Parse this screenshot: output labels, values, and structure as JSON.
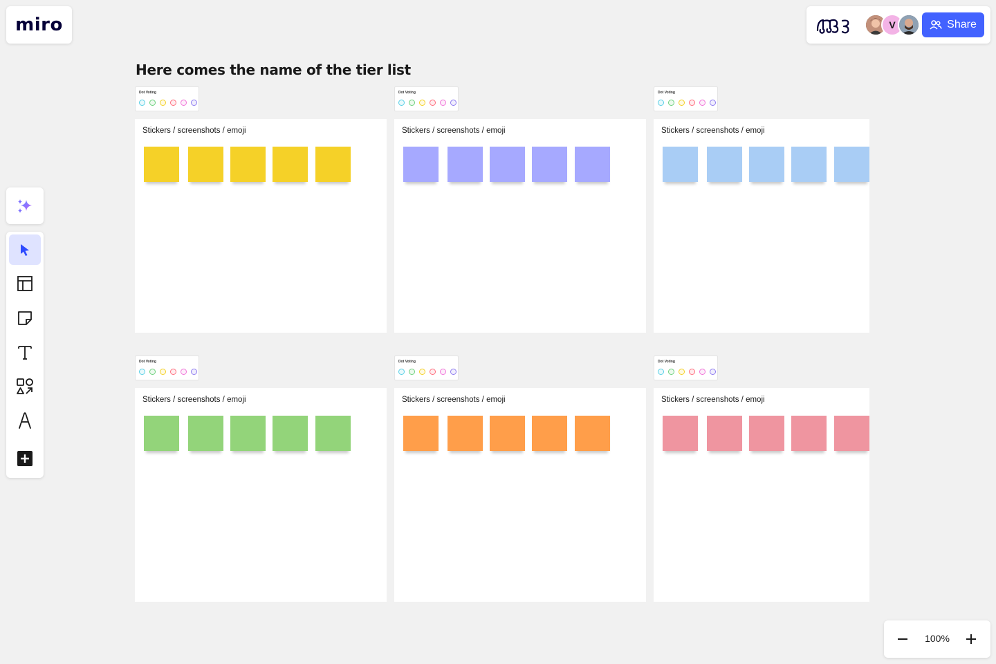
{
  "app": {
    "logo_text": "miro",
    "share_label": "Share",
    "avatar_initial": "V"
  },
  "board": {
    "title": "Here comes the name of the tier list"
  },
  "tiers": [
    {
      "dot_voting_label": "Dot Voting",
      "label": "Stickers / screenshots / emoji",
      "sticky_color": "#f5d128",
      "sticky_count": 5
    },
    {
      "dot_voting_label": "Dot Voting",
      "label": "Stickers / screenshots / emoji",
      "sticky_color": "#a6a9ff",
      "sticky_count": 5
    },
    {
      "dot_voting_label": "Dot Voting",
      "label": "Stickers / screenshots / emoji",
      "sticky_color": "#a9cdf5",
      "sticky_count": 5
    },
    {
      "dot_voting_label": "Dot Voting",
      "label": "Stickers / screenshots / emoji",
      "sticky_color": "#93d47a",
      "sticky_count": 5
    },
    {
      "dot_voting_label": "Dot Voting",
      "label": "Stickers / screenshots / emoji",
      "sticky_color": "#ff9e4a",
      "sticky_count": 5
    },
    {
      "dot_voting_label": "Dot Voting",
      "label": "Stickers / screenshots / emoji",
      "sticky_color": "#ef95a0",
      "sticky_count": 5
    }
  ],
  "dot_colors": [
    "#5ad0e6",
    "#6fd17f",
    "#f5d128",
    "#ff6f7f",
    "#f176d9",
    "#8f7cf0"
  ],
  "toolbar": {
    "tools": [
      "ai-sparkle-icon",
      "select-cursor-icon",
      "templates-icon",
      "sticky-note-icon",
      "text-icon",
      "shapes-icon",
      "pen-icon",
      "more-tools-icon"
    ],
    "active_tool": "select-cursor-icon",
    "accent_color": "#4262ff"
  },
  "zoom": {
    "level": "100%"
  }
}
